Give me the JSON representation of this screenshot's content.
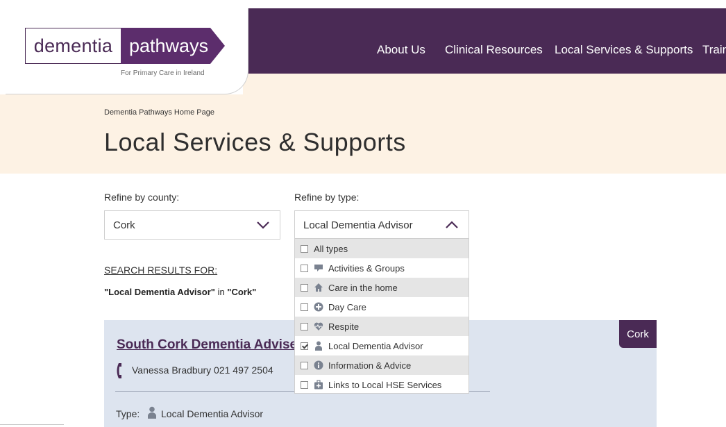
{
  "brand": {
    "logo_word1": "dementia",
    "logo_word2": "pathways",
    "tagline": "For Primary Care in Ireland"
  },
  "nav": {
    "items": [
      "About Us",
      "Clinical Resources",
      "Local Services & Supports",
      "Traini"
    ]
  },
  "breadcrumb": "Dementia Pathways Home Page",
  "page_title": "Local Services & Supports",
  "filters": {
    "county_label": "Refine by county:",
    "county_value": "Cork",
    "type_label": "Refine by type:",
    "type_value": "Local Dementia Advisor",
    "type_options": [
      {
        "label": "All types",
        "icon": "none",
        "checked": false
      },
      {
        "label": "Activities & Groups",
        "icon": "speech-bubble-icon",
        "checked": false
      },
      {
        "label": "Care in the home",
        "icon": "house-icon",
        "checked": false
      },
      {
        "label": "Day Care",
        "icon": "plus-circle-icon",
        "checked": false
      },
      {
        "label": "Respite",
        "icon": "heart-pulse-icon",
        "checked": false
      },
      {
        "label": "Local Dementia Advisor",
        "icon": "person-icon",
        "checked": true
      },
      {
        "label": "Information & Advice",
        "icon": "info-icon",
        "checked": false
      },
      {
        "label": "Links to Local HSE Services",
        "icon": "medical-kit-icon",
        "checked": false
      }
    ]
  },
  "results": {
    "heading": "SEARCH RESULTS FOR:",
    "query_type": "\"Local Dementia Advisor\"",
    "connector": " in ",
    "query_county": "\"Cork\""
  },
  "card": {
    "title": "South Cork Dementia Adviser",
    "badge": "Cork",
    "phone": "Vanessa Bradbury 021 497 2504",
    "type_label": "Type:",
    "type_value": "Local Dementia Advisor"
  },
  "colors": {
    "brand_purple": "#4a2a55",
    "logo_purple": "#5c2d6c",
    "hero_cream": "#fdf2e4",
    "card_blue": "#dde4ef",
    "icon_grey": "#7a8290"
  }
}
